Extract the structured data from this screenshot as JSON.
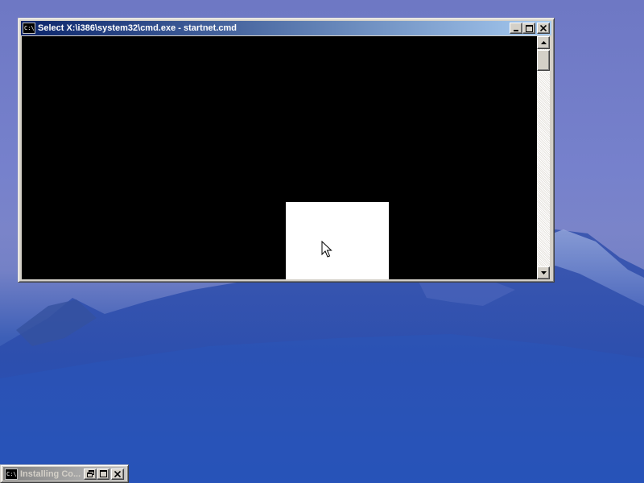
{
  "desktop": {
    "wallpaper": "mountain-dusk"
  },
  "cmd_window": {
    "title": "Select X:\\i386\\system32\\cmd.exe - startnet.cmd",
    "icon_label": "C:\\",
    "icon": "console-icon",
    "buttons": [
      "minimize",
      "maximize",
      "close"
    ],
    "console_text": "",
    "state": "selecting"
  },
  "minimized_window": {
    "title": "Installing Co...",
    "icon_label": "C:\\",
    "icon": "console-icon",
    "buttons": [
      "restore",
      "maximize",
      "close"
    ]
  },
  "colors": {
    "active_title": "#0a246a",
    "inactive_title": "#808080",
    "console_bg": "#000000",
    "selection": "#ffffff",
    "window_face": "#d4d0c8"
  }
}
